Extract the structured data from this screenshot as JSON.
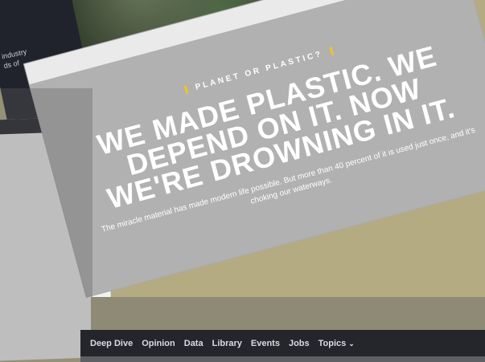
{
  "background_photo": {
    "caption_fragments": [
      "industry",
      "ds of"
    ]
  },
  "hero": {
    "kicker": "PLANET OR PLASTIC?",
    "headline_lines": [
      "WE MADE PLASTIC. WE",
      "DEPEND ON IT. NOW",
      "WE'RE DROWNING IN IT."
    ],
    "dek": "The miracle material has made modern life possible. But more than 40 percent of it is used just once, and it's choking our waterways.",
    "accent_color": "#f3c322"
  },
  "nav": {
    "items": [
      {
        "label": "Deep Dive"
      },
      {
        "label": "Opinion"
      },
      {
        "label": "Data"
      },
      {
        "label": "Library"
      },
      {
        "label": "Events"
      },
      {
        "label": "Jobs"
      },
      {
        "label": "Topics",
        "icon": "chevron-down-icon"
      }
    ]
  }
}
